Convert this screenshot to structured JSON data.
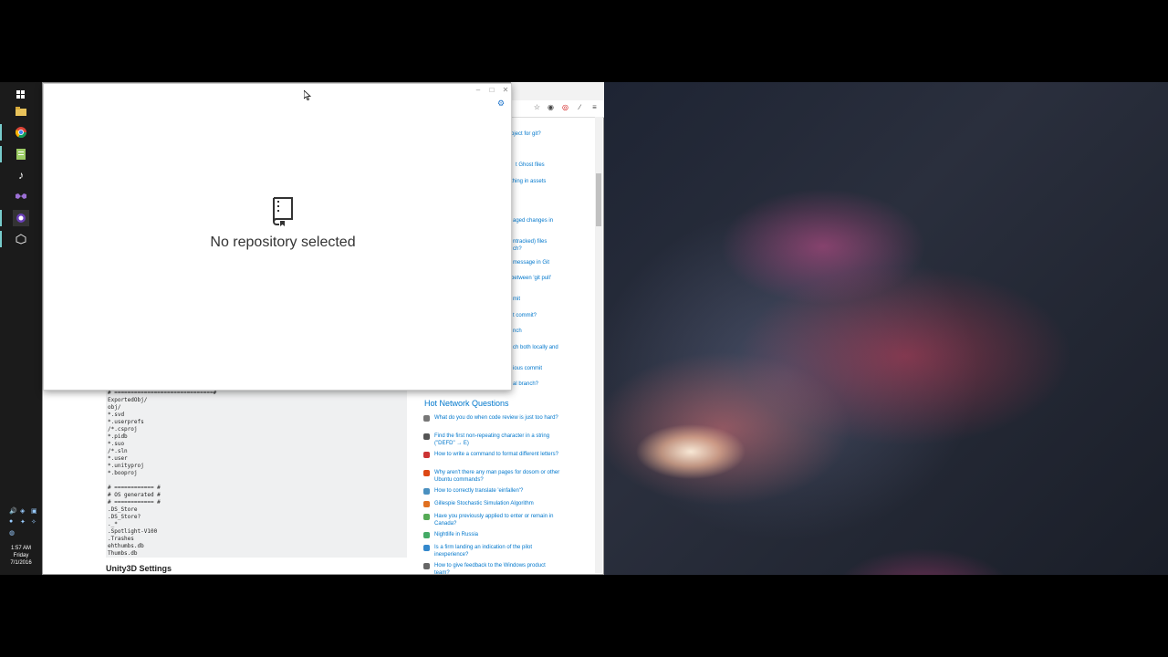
{
  "taskbar": {
    "icons": [
      "windows-icon",
      "file-explorer-icon",
      "chrome-icon",
      "notepad-icon",
      "music-icon",
      "visual-studio-icon",
      "github-desktop-icon",
      "unity-icon"
    ],
    "clock": {
      "time": "1:57 AM",
      "day": "Friday",
      "date": "7/1/2016"
    }
  },
  "browser": {
    "side_links": [
      "oject for git?",
      "t Ghost files",
      "thing in assets",
      "aged changes in",
      "ntracked) files",
      "ch?",
      "message in Git",
      "between 'git pull'",
      "mit",
      "t commit?",
      "nch",
      "ch both locally and",
      "ious commit",
      "al branch?"
    ],
    "code_lines": "# ==============================#\nExportedObj/\nobj/\n*.svd\n*.userprefs\n/*.csproj\n*.pidb\n*.suo\n/*.sln\n*.user\n*.unityproj\n*.booproj\n\n# ============ #\n# OS generated #\n# ============ #\n.DS_Store\n.DS_Store?\n._*\n.Spotlight-V100\n.Trashes\nehthumbs.db\nThumbs.db",
    "section_heading": "Unity3D Settings",
    "hnq_title": "Hot Network Questions",
    "hnq_items": [
      {
        "text": "What do you do when code review is just too hard?",
        "color": "#777777"
      },
      {
        "text": "Find the first non-repeating character in a string (\"DEFD\" → E)",
        "color": "#555555"
      },
      {
        "text": "How to write a command to format different letters?",
        "color": "#cc3333"
      },
      {
        "text": "Why aren't there any man pages for dosom or other Ubuntu commands?",
        "color": "#dd4814"
      },
      {
        "text": "How to correctly translate 'einfallen'?",
        "color": "#4a90c0"
      },
      {
        "text": "Gillespie Stochastic Simulation Algorithm",
        "color": "#e07020"
      },
      {
        "text": "Have you previously applied to enter or remain in Canada?",
        "color": "#55aa55"
      },
      {
        "text": "Nightlife in Russia",
        "color": "#44aa66"
      },
      {
        "text": "Is a firm landing an indication of the pilot inexperience?",
        "color": "#3388cc"
      },
      {
        "text": "How to give feedback to the Windows product team?",
        "color": "#666666"
      }
    ]
  },
  "github_window": {
    "empty_state_text": "No repository selected"
  }
}
